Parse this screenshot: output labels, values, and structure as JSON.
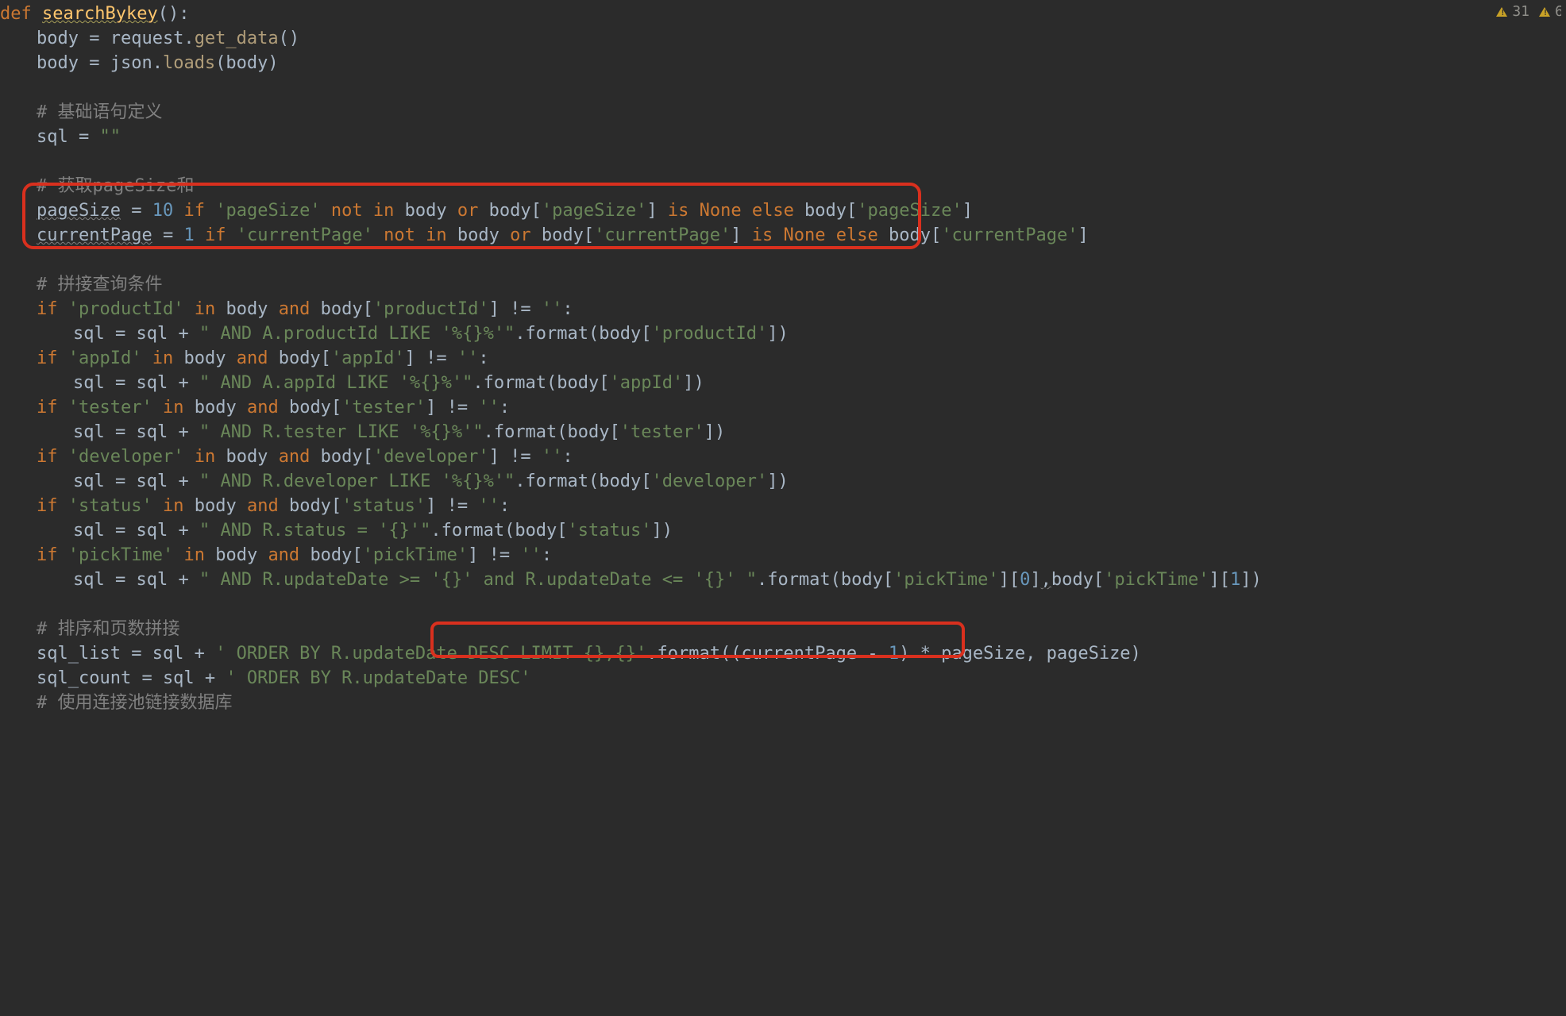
{
  "warnings": {
    "count1": "31"
  },
  "code": {
    "l1": {
      "def": "def",
      "name": "searchBykey",
      "post": "():"
    },
    "l2": {
      "a": "body = request.",
      "m": "get_data",
      "b": "()"
    },
    "l3": {
      "a": "body = json.",
      "m": "loads",
      "b": "(body)"
    },
    "c1": "# 基础语句定义",
    "l4": {
      "a": "sql = ",
      "s": "\"\""
    },
    "c2": "# 获取pageSize和",
    "l5": {
      "v": "pageSize",
      "eq": " = ",
      "n": "10",
      "sp1": " ",
      "if": "if",
      "sp2": " ",
      "s1": "'pageSize'",
      "sp3": " ",
      "not": "not",
      "sp4": " ",
      "in": "in",
      "sp5": " body ",
      "or": "or",
      "sp6": " body[",
      "s2": "'pageSize'",
      "post1": "] ",
      "is": "is",
      "sp7": " ",
      "none": "None",
      "sp8": " ",
      "else": "else",
      "sp9": " body[",
      "s3": "'pageSize'",
      "post2": "]"
    },
    "l6": {
      "v": "currentPage",
      "eq": " = ",
      "n": "1",
      "sp1": " ",
      "if": "if",
      "sp2": " ",
      "s1": "'currentPage'",
      "sp3": " ",
      "not": "not",
      "sp4": " ",
      "in": "in",
      "sp5": " body ",
      "or": "or",
      "sp6": " body[",
      "s2": "'currentPage'",
      "post1": "] ",
      "is": "is",
      "sp7": " ",
      "none": "None",
      "sp8": " ",
      "else": "else",
      "sp9": " body[",
      "s3": "'currentPage'",
      "post2": "]"
    },
    "c3": "# 拼接查询条件",
    "cond": [
      {
        "key": "productId",
        "sql_str": "\" AND A.productId LIKE '%{}%'\"",
        "body": "body",
        "cmp": " != ",
        "emp": "''"
      },
      {
        "key": "appId",
        "sql_str": "\" AND A.appId LIKE '%{}%'\"",
        "body": "body",
        "cmp": " != ",
        "emp": "''"
      },
      {
        "key": "tester",
        "sql_str": "\" AND R.tester LIKE '%{}%'\"",
        "body": "body",
        "cmp": " != ",
        "emp": "''"
      },
      {
        "key": "developer",
        "sql_str": "\" AND R.developer LIKE '%{}%'\"",
        "body": "body",
        "cmp": " != ",
        "emp": "''"
      },
      {
        "key": "status",
        "sql_str": "\" AND R.status = '{}'\"",
        "body": "body",
        "cmp": " != ",
        "emp": "''"
      }
    ],
    "pick": {
      "if": "if",
      "key": "'pickTime'",
      "in": "in",
      "body": "body",
      "and": "and",
      "bracket": "body[",
      "key2": "'pickTime'",
      "post": "] != ",
      "emp": "''",
      "colon": ":",
      "assign": "sql = sql + ",
      "s": "\" AND R.updateDate >= '{}' and R.updateDate <= '{}' \"",
      "fmt": ".format(",
      "arg1_pre": "body[",
      "k": "'pickTime'",
      "arg1_post": "][",
      "z": "0",
      "arg1_end": "]",
      "comma": ",",
      "arg2_pre": "body[",
      "arg2_post": "][",
      "one": "1",
      "arg2_end": "])"
    },
    "c4": "# 排序和页数拼接",
    "l_list": {
      "a": "sql_list = sql + ",
      "s": "' ORDER BY R.updateDate DESC LIMIT {},{}'",
      "fmt": ".format(",
      "p1": "(currentPage - ",
      "one": "1",
      "p2": ") * pageSize",
      "comma": ", ",
      "p3": "pageSize)"
    },
    "l_count": {
      "a": "sql_count = sql + ",
      "s": "' ORDER BY R.updateDate DESC'"
    },
    "c5": "# 使用连接池链接数据库"
  }
}
